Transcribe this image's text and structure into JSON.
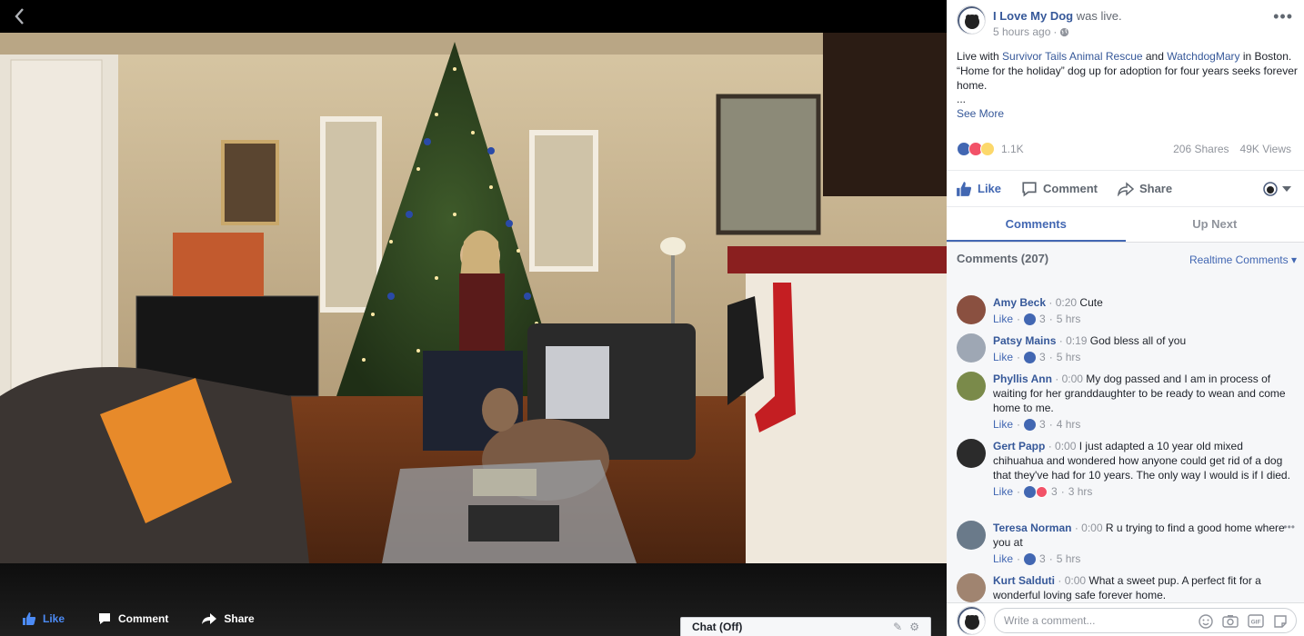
{
  "video": {
    "actions": {
      "like": "Like",
      "comment": "Comment",
      "share": "Share"
    },
    "chat_label": "Chat (Off)"
  },
  "post": {
    "page_name": "I Love My Dog",
    "was_live": "was live.",
    "time_ago": "5 hours ago",
    "more": "•••",
    "text_live_with": "Live with ",
    "mention_1": "Survivor Tails Animal Rescue",
    "text_and": " and ",
    "mention_2": "WatchdogMary",
    "text_rest": " in Boston. “Home for the holiday” dog up for adoption for four years seeks forever home.",
    "ellipsis": "...",
    "see_more": "See More",
    "reaction_count": "1.1K",
    "shares": "206 Shares",
    "views": "49K Views",
    "colors": {
      "brand": "#4267b2",
      "link": "#365899",
      "love": "#f25268",
      "haha": "#fcd86b"
    }
  },
  "actions": {
    "like": "Like",
    "comment": "Comment",
    "share": "Share"
  },
  "tabs": [
    {
      "label": "Comments",
      "active": true
    },
    {
      "label": "Up Next",
      "active": false
    }
  ],
  "comments_header": {
    "count": "Comments (207)",
    "realtime": "Realtime Comments ▾"
  },
  "comments": [
    {
      "author": "Amy Beck",
      "time": "0:20",
      "text": "Cute",
      "like": "Like",
      "reactions": "3",
      "ago": "5 hrs",
      "love": false
    },
    {
      "author": "Patsy Mains",
      "time": "0:19",
      "text": "God bless all of you",
      "like": "Like",
      "reactions": "3",
      "ago": "5 hrs",
      "love": false
    },
    {
      "author": "Phyllis Ann",
      "time": "0:00",
      "text": "My dog passed and I am in process of waiting for her granddaughter to be ready to wean and come home to me.",
      "like": "Like",
      "reactions": "3",
      "ago": "4 hrs",
      "love": false
    },
    {
      "author": "Gert Papp",
      "time": "0:00",
      "text": "I just adapted a 10 year old mixed chihuahua and wondered how anyone could get rid of a dog that they've had for 10 years. The only way I would is if I died.",
      "like": "Like",
      "reactions": "3",
      "ago": "3 hrs",
      "love": true
    },
    {
      "author": "Teresa Norman",
      "time": "0:00",
      "text": "R u trying to find a good home where you at",
      "like": "Like",
      "reactions": "3",
      "ago": "5 hrs",
      "love": false
    },
    {
      "author": "Kurt Salduti",
      "time": "0:00",
      "text": "What a sweet pup. A perfect fit for a wonderful loving safe forever home.",
      "like": "",
      "reactions": "",
      "ago": "",
      "love": false
    }
  ],
  "comment_more": "•••",
  "write": {
    "placeholder": "Write a comment..."
  }
}
